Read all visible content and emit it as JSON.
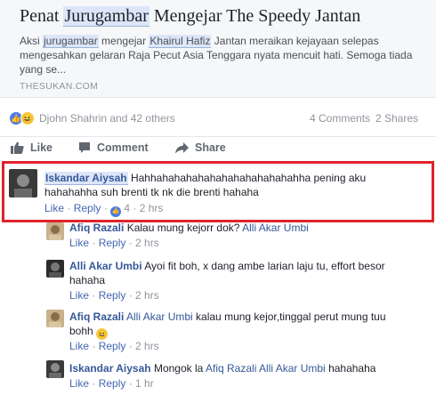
{
  "link_card": {
    "title_pre": "Penat ",
    "title_hl": "Jurugambar",
    "title_post": " Mengejar The Speedy Jantan",
    "desc_pre": "Aksi ",
    "desc_hl1": "jurugambar",
    "desc_mid": " mengejar ",
    "desc_hl2": "Khairul Hafiz",
    "desc_post": " Jantan meraikan kejayaan selepas mengesahkan gelaran Raja Pecut Asia Tenggara nyata mencuit hati. Semoga tiada yang se...",
    "domain": "THESUKAN.COM"
  },
  "reactions": {
    "names": "Djohn Shahrin and 42 others",
    "comments": "4 Comments",
    "shares": "2 Shares",
    "like_icon": "like-reaction-icon",
    "haha_icon": "haha-reaction-icon"
  },
  "actions": {
    "like": "Like",
    "comment": "Comment",
    "share": "Share"
  },
  "comments": [
    {
      "author": "Iskandar Aiysah",
      "text": "Hahhahahahahahahahahahahahahha pening aku hahahahha suh brenti tk nk die brenti hahaha",
      "like": "Like",
      "reply": "Reply",
      "reactions": "4",
      "time": "2 hrs"
    },
    {
      "author": "Afiq Razali",
      "text": "Kalau mung kejorr dok?",
      "mention": "Alli Akar Umbi",
      "like": "Like",
      "reply": "Reply",
      "time": "2 hrs"
    },
    {
      "author": "Alli Akar Umbi",
      "text": "Ayoi fit boh, x dang ambe larian laju tu, effort besor hahaha",
      "like": "Like",
      "reply": "Reply",
      "time": "2 hrs"
    },
    {
      "author": "Afiq Razali",
      "mention": "Alli Akar Umbi",
      "text": "kalau mung kejor,tinggal perut mung tuu bohh",
      "like": "Like",
      "reply": "Reply",
      "time": "2 hrs"
    },
    {
      "author": "Iskandar Aiysah",
      "text": "Mongok la",
      "mention1": "Afiq Razali",
      "mention2": "Alli Akar Umbi",
      "text_end": "hahahaha",
      "like": "Like",
      "reply": "Reply",
      "time": "1 hr"
    }
  ],
  "meta_sep": " · "
}
